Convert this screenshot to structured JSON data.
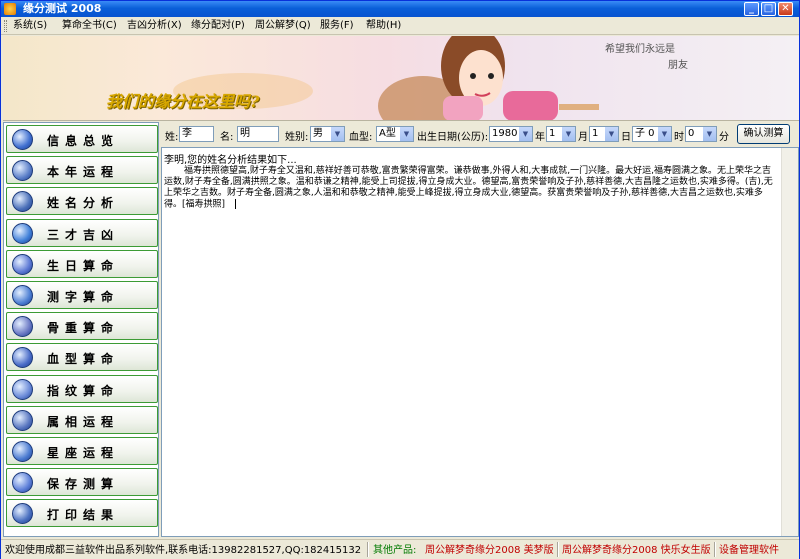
{
  "window": {
    "title": "缘分测试 2008"
  },
  "menu": [
    {
      "label": "系统(S)"
    },
    {
      "label": "算命全书(C)"
    },
    {
      "label": "吉凶分析(X)"
    },
    {
      "label": "缘分配对(P)"
    },
    {
      "label": "周公解梦(Q)"
    },
    {
      "label": "服务(F)"
    },
    {
      "label": "帮助(H)"
    }
  ],
  "banner": {
    "slogan": "我们的缘分在这里吗?",
    "wish_line1": "希望我们永远是",
    "wish_line2": "朋友"
  },
  "sidebar": {
    "items": [
      {
        "label": "信息总览",
        "icon": "globe-icon"
      },
      {
        "label": "本年运程",
        "icon": "eye-icon"
      },
      {
        "label": "姓名分析",
        "icon": "document-icon"
      },
      {
        "label": "三才吉凶",
        "icon": "computer-icon"
      },
      {
        "label": "生日算命",
        "icon": "person-icon"
      },
      {
        "label": "测字算命",
        "icon": "book-icon"
      },
      {
        "label": "骨重算命",
        "icon": "chart-icon"
      },
      {
        "label": "血型算命",
        "icon": "sparkle-icon"
      },
      {
        "label": "指纹算命",
        "icon": "star-icon"
      },
      {
        "label": "属相运程",
        "icon": "clipboard-icon"
      },
      {
        "label": "星座运程",
        "icon": "constellation-icon"
      },
      {
        "label": "保存测算",
        "icon": "folder-icon"
      },
      {
        "label": "打印结果",
        "icon": "printer-icon"
      }
    ]
  },
  "form": {
    "surname_label": "姓:",
    "surname_value": "李",
    "name_label": "名:",
    "name_value": "明",
    "gender_label": "姓别:",
    "gender_value": "男",
    "blood_label": "血型:",
    "blood_value": "A型",
    "birth_label": "出生日期(公历):",
    "year_value": "1980",
    "year_unit": "年",
    "month_value": "1",
    "month_unit": "月",
    "day_value": "1",
    "day_unit": "日",
    "hour_value": "子 0",
    "hour_unit": "时",
    "minute_value": "0",
    "minute_unit": "分",
    "confirm_label": "确认测算"
  },
  "result": {
    "heading": "李明,您的姓名分析结果如下...",
    "body": "福寿拱照德望高,财子寿全又温和,慈祥好善可恭敬,富贵繁荣得富荣。谦恭做事,外得人和,大事成就,一门兴隆。最大好运,福寿圆满之象。无上荣华之吉运数,财子寿全备,圆满拱照之象。温和恭谦之精神,能受上司提拔,得立身成大业。德望高,富贵荣誉响及子孙,慈祥善德,大吉昌隆之运数也,实难多得。(吉),无上荣华之吉数。财子寿全备,圆满之象,人温和和恭敬之精神,能受上峰提拔,得立身成大业,德望高。获富贵荣誉响及子孙,慈祥善德,大吉昌之运数也,实难多得。[福寿拱照]"
  },
  "status": {
    "welcome": "欢迎使用成都三益软件出品系列软件,联系电话:13982281527,QQ:182415132",
    "other_products_label": "其他产品:",
    "product1": "周公解梦奇缘分2008 美梦版",
    "product2": "周公解梦奇缘分2008 快乐女生版",
    "product3": "设备管理软件"
  },
  "colors": {
    "side_border": "#3c9b35",
    "title_blue": "#0a5fd8",
    "status_red": "#c00000",
    "status_green": "#007a00"
  }
}
